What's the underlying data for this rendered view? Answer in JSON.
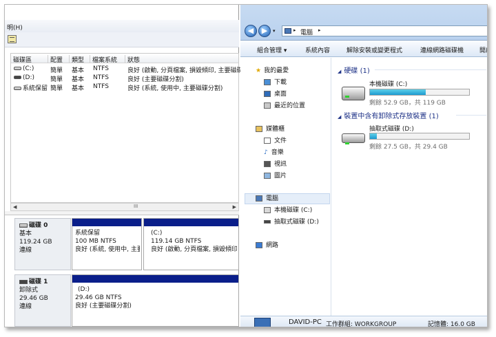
{
  "disk_mgmt": {
    "menu_help": "明(H)",
    "columns": [
      "磁碟區",
      "配置",
      "類型",
      "檔案系統",
      "狀態"
    ],
    "volumes": [
      {
        "name": "(C:)",
        "layout": "簡單",
        "type": "基本",
        "fs": "NTFS",
        "status": "良好 (啟動, 分頁檔案, 損毀傾印, 主要磁碟分割)"
      },
      {
        "name": "(D:)",
        "layout": "簡單",
        "type": "基本",
        "fs": "NTFS",
        "status": "良好 (主要磁碟分割)"
      },
      {
        "name": "系統保留",
        "layout": "簡單",
        "type": "基本",
        "fs": "NTFS",
        "status": "良好 (系統, 使用中, 主要磁碟分割)"
      }
    ],
    "scroll_thumb": "III",
    "disks": [
      {
        "title": "磁碟 0",
        "kind": "基本",
        "size": "119.24 GB",
        "state": "連線",
        "partitions": [
          {
            "name": "系統保留",
            "size": "100 MB NTFS",
            "status": "良好 (系統, 使用中, 主要"
          },
          {
            "name": "(C:)",
            "size": "119.14 GB NTFS",
            "status": "良好 (啟動, 分頁檔案, 損毀傾印, 主"
          }
        ]
      },
      {
        "title": "磁碟 1",
        "kind": "卸除式",
        "size": "29.46 GB",
        "state": "連線",
        "partitions": [
          {
            "name": "(D:)",
            "size": "29.46 GB NTFS",
            "status": "良好 (主要磁碟分割)"
          }
        ]
      }
    ]
  },
  "explorer": {
    "breadcrumb": "電腦",
    "commands": [
      "組合管理 ▾",
      "系統內容",
      "解除安裝或變更程式",
      "連線網路磁碟機",
      "開啟"
    ],
    "nav": {
      "favorites": "我的最愛",
      "fav_items": [
        "下載",
        "桌面",
        "最近的位置"
      ],
      "libraries": "媒體櫃",
      "lib_items": [
        "文件",
        "音樂",
        "視訊",
        "圖片"
      ],
      "computer": "電腦",
      "computer_items": [
        "本機磁碟 (C:)",
        "抽取式磁碟 (D:)"
      ],
      "network": "網路"
    },
    "groups": [
      {
        "header": "硬碟 (1)",
        "drive": "本機磁碟 (C:)",
        "info": "剩餘 52.9 GB，共 119 GB",
        "used_fraction": 0.56,
        "color": "#1c9ad1"
      },
      {
        "header": "裝置中含有卸除式存放裝置 (1)",
        "drive": "抽取式磁碟 (D:)",
        "info": "剩餘 27.5 GB，共 29.4 GB",
        "used_fraction": 0.07,
        "color": "#1c9ad1"
      }
    ],
    "details": {
      "pc_name": "DAVID-PC",
      "workgroup": "工作群組: WORKGROUP",
      "memory": "記憶體: 16.0 GB"
    }
  }
}
